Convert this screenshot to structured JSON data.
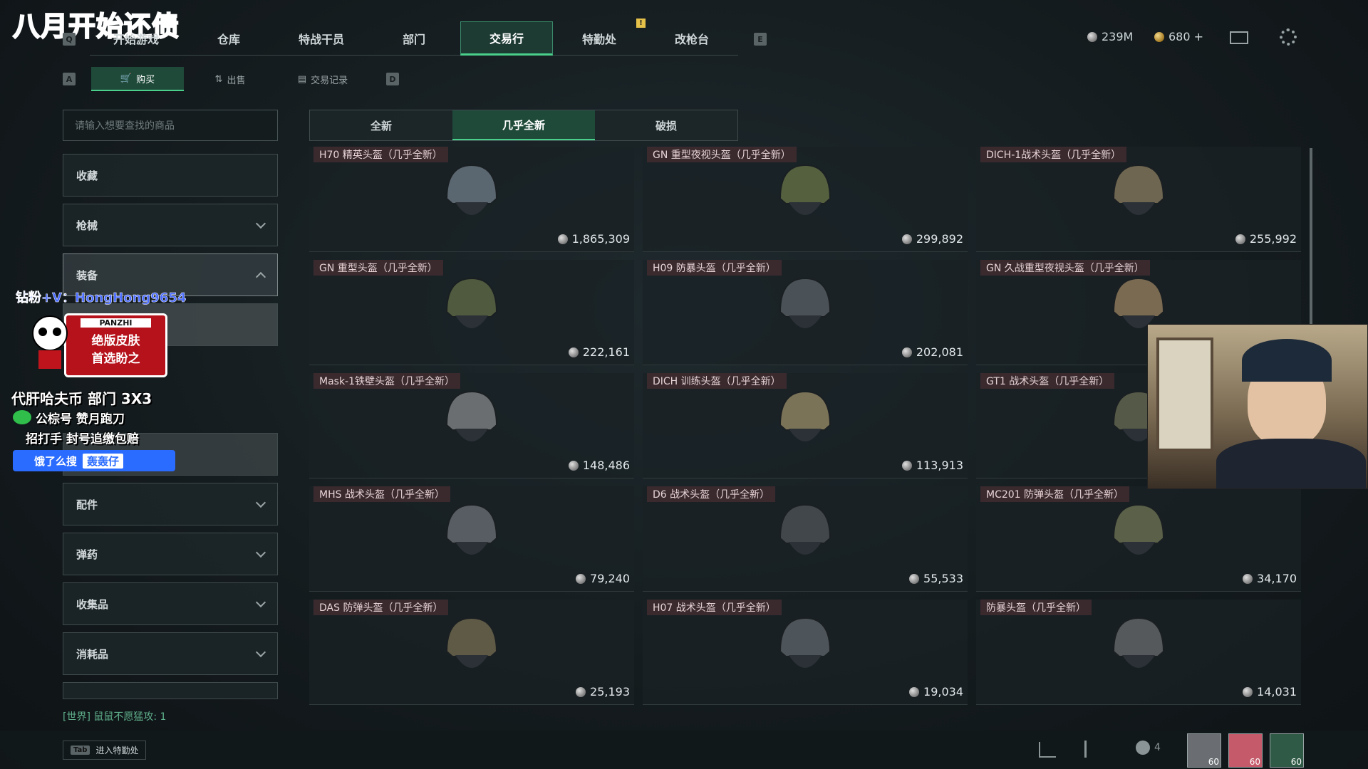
{
  "overlay": {
    "title": "八月开始还债",
    "wechat": "钻粉+V：HongHong9654",
    "badge_top": "PANZHI",
    "badge_line1": "绝版皮肤",
    "badge_line2": "首选盼之",
    "promo1": "代肝哈夫币 部门 3X3",
    "promo2": "公棕号 赞月跑刀",
    "promo3": "招打手 封号追缴包赔",
    "search_label": "饿了么搜",
    "search_tag": "轰轰仔"
  },
  "nav": {
    "left_key": "Q",
    "right_key": "E",
    "tabs": [
      "开始游戏",
      "仓库",
      "特战干员",
      "部门",
      "交易行",
      "特勤处",
      "改枪台"
    ],
    "active": "交易行"
  },
  "subnav": {
    "left_key": "A",
    "right_key": "D",
    "tabs": [
      "购买",
      "出售",
      "交易记录"
    ]
  },
  "currency": {
    "silver": "239M",
    "gold": "680 +"
  },
  "sidebar": {
    "search_placeholder": "请输入想要查找的商品",
    "categories": [
      "收藏",
      "枪械",
      "装备",
      "",
      "",
      "配件",
      "弹药",
      "收集品",
      "消耗品"
    ]
  },
  "quality_tabs": [
    "全新",
    "几乎全新",
    "破损"
  ],
  "items": [
    {
      "name": "H70 精英头盔（几乎全新）",
      "price": "1,865,309",
      "color": "#5a6670"
    },
    {
      "name": "GN 重型夜视头盔（几乎全新）",
      "price": "299,892",
      "color": "#55603f"
    },
    {
      "name": "DICH-1战术头盔（几乎全新）",
      "price": "255,992",
      "color": "#6e6650"
    },
    {
      "name": "GN 重型头盔（几乎全新）",
      "price": "222,161",
      "color": "#4f5a3e"
    },
    {
      "name": "H09 防暴头盔（几乎全新）",
      "price": "202,081",
      "color": "#4a5258"
    },
    {
      "name": "GN 久战重型夜视头盔（几乎全新）",
      "price": "",
      "color": "#7a6a52"
    },
    {
      "name": "Mask-1铁壁头盔（几乎全新）",
      "price": "148,486",
      "color": "#6a6e70"
    },
    {
      "name": "DICH 训练头盔（几乎全新）",
      "price": "113,913",
      "color": "#7b7358"
    },
    {
      "name": "GT1 战术头盔（几乎全新）",
      "price": "",
      "color": "#555a48"
    },
    {
      "name": "MHS 战术头盔（几乎全新）",
      "price": "79,240",
      "color": "#575d63"
    },
    {
      "name": "D6 战术头盔（几乎全新）",
      "price": "55,533",
      "color": "#42474b"
    },
    {
      "name": "MC201 防弹头盔（几乎全新）",
      "price": "34,170",
      "color": "#5a6148"
    },
    {
      "name": "DAS 防弹头盔（几乎全新）",
      "price": "25,193",
      "color": "#5e5a46"
    },
    {
      "name": "H07 战术头盔（几乎全新）",
      "price": "19,034",
      "color": "#4e555a"
    },
    {
      "name": "防暴头盔（几乎全新）",
      "price": "14,031",
      "color": "#55595c"
    }
  ],
  "world_message": "[世界] 鼠鼠不愿猛攻: 1",
  "bottom": {
    "tab_key": "Tab",
    "tab_label": "进入特勤处",
    "friends": "4",
    "level1": "60",
    "level2": "60",
    "level3": "60"
  }
}
